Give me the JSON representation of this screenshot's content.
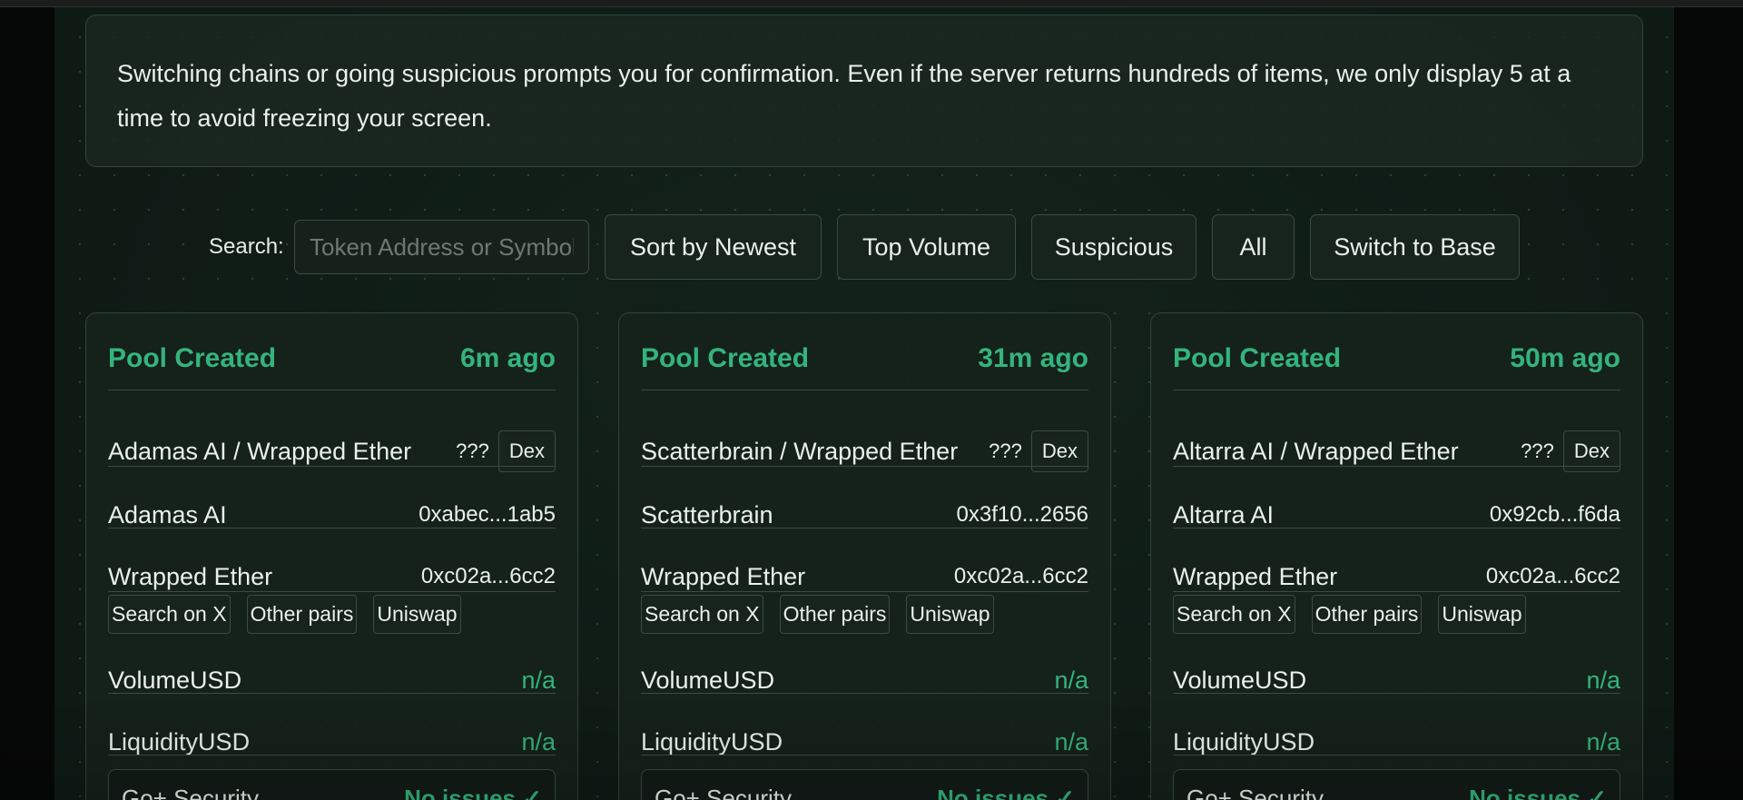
{
  "info_text": "Switching chains or going suspicious prompts you for confirmation. Even if the server returns hundreds of items, we only display 5 at a time to avoid freezing your screen.",
  "search": {
    "label": "Search:",
    "placeholder": "Token Address or Symbol",
    "value": ""
  },
  "toolbar": {
    "sort_newest": "Sort by Newest",
    "top_volume": "Top Volume",
    "suspicious": "Suspicious",
    "all": "All",
    "switch_chain": "Switch to Base"
  },
  "colors": {
    "accent_green": "#34b47c",
    "background": "#0f1a15",
    "border": "#3a4c43"
  },
  "cards": [
    {
      "title": "Pool Created",
      "age": "6m ago",
      "pair": "Adamas AI / Wrapped Ether",
      "unknown_mark": "???",
      "dex_label": "Dex",
      "token0_name": "Adamas AI",
      "token0_addr": "0xabec...1ab5",
      "token1_name": "Wrapped Ether",
      "token1_addr": "0xc02a...6cc2",
      "links": [
        "Search on X",
        "Other pairs",
        "Uniswap"
      ],
      "volume_label": "VolumeUSD",
      "volume_value": "n/a",
      "liquidity_label": "LiquidityUSD",
      "liquidity_value": "n/a",
      "security_label": "Go+ Security",
      "security_value": "No issues ✓"
    },
    {
      "title": "Pool Created",
      "age": "31m ago",
      "pair": "Scatterbrain / Wrapped Ether",
      "unknown_mark": "???",
      "dex_label": "Dex",
      "token0_name": "Scatterbrain",
      "token0_addr": "0x3f10...2656",
      "token1_name": "Wrapped Ether",
      "token1_addr": "0xc02a...6cc2",
      "links": [
        "Search on X",
        "Other pairs",
        "Uniswap"
      ],
      "volume_label": "VolumeUSD",
      "volume_value": "n/a",
      "liquidity_label": "LiquidityUSD",
      "liquidity_value": "n/a",
      "security_label": "Go+ Security",
      "security_value": "No issues ✓"
    },
    {
      "title": "Pool Created",
      "age": "50m ago",
      "pair": "Altarra AI / Wrapped Ether",
      "unknown_mark": "???",
      "dex_label": "Dex",
      "token0_name": "Altarra AI",
      "token0_addr": "0x92cb...f6da",
      "token1_name": "Wrapped Ether",
      "token1_addr": "0xc02a...6cc2",
      "links": [
        "Search on X",
        "Other pairs",
        "Uniswap"
      ],
      "volume_label": "VolumeUSD",
      "volume_value": "n/a",
      "liquidity_label": "LiquidityUSD",
      "liquidity_value": "n/a",
      "security_label": "Go+ Security",
      "security_value": "No issues ✓"
    }
  ]
}
